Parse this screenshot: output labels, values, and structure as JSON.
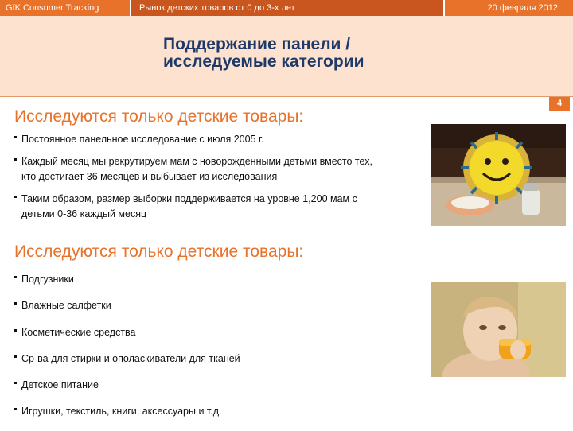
{
  "topbar": {
    "brand": "GfK Consumer Tracking",
    "project": "Рынок детских товаров от 0 до 3-х лет",
    "date": "20 февраля 2012"
  },
  "header": {
    "title_line1": "Поддержание панели /",
    "title_line2": "исследуемые категории"
  },
  "page_number": "4",
  "section1": {
    "heading": "Исследуются только детские товары:",
    "bullets": [
      [
        "Постоянное панельное исследование с июля 2005 г."
      ],
      [
        "Каждый месяц мы рекрутируем мам с новорожденными детьми вместо тех,",
        "кто достигает 36 месяцев и выбывает из исследования"
      ],
      [
        "Таким образом, размер выборки поддерживается на уровне 1,200 мам с",
        "детьми 0-36 каждый месяц"
      ]
    ]
  },
  "section2": {
    "heading": "Исследуются только детские товары:",
    "bullets": [
      "Подгузники",
      "Влажные салфетки",
      "Косметические средства",
      "Ср-ва для стирки и ополаскиватели для тканей",
      "Детское питание",
      "Игрушки, текстиль, книги, аксессуары и т.д."
    ]
  },
  "colors": {
    "accent": "#e8722a",
    "accent_dark": "#c9561e",
    "header_bg": "#fde3cf",
    "title": "#1f3a68"
  }
}
